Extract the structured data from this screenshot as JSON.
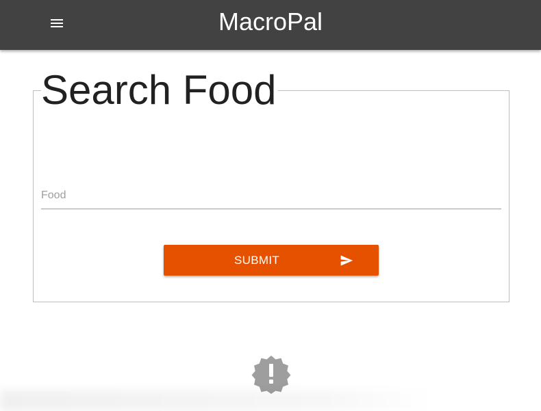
{
  "app": {
    "title": "MacroPal",
    "menu_icon": "hamburger-menu-icon"
  },
  "search_form": {
    "legend": "Search Food",
    "food_input": {
      "placeholder": "Food",
      "value": ""
    },
    "submit": {
      "label": "SUBMIT",
      "icon": "send-icon"
    }
  },
  "status": {
    "icon": "alert-badge-icon"
  },
  "colors": {
    "appbar": "#424242",
    "accent": "#e65100",
    "badge": "#9e9e9e"
  }
}
